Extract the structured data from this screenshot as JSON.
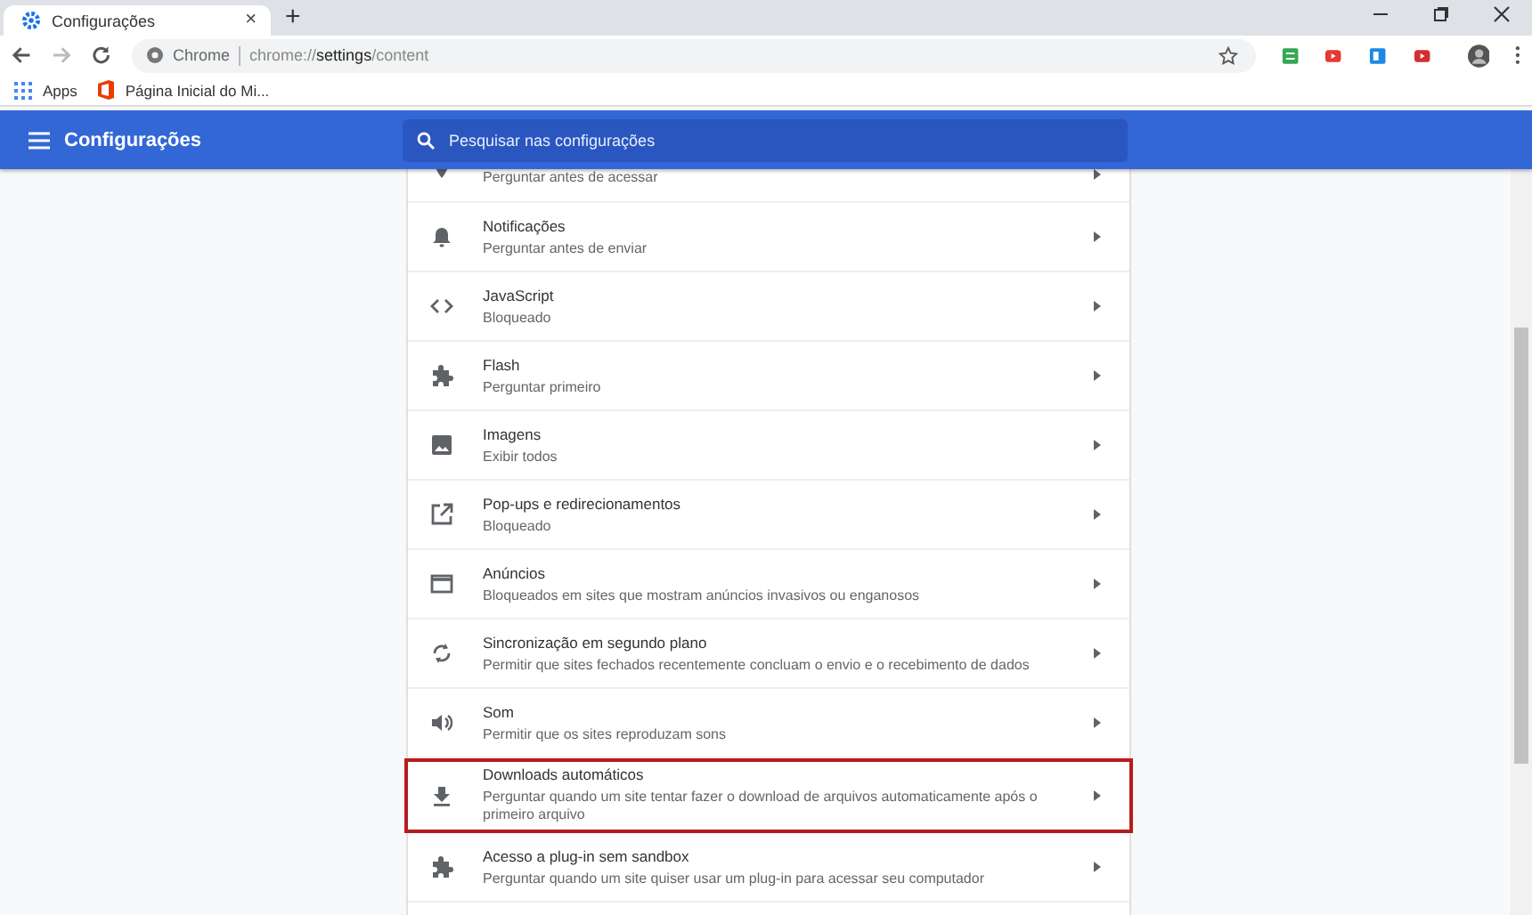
{
  "browser": {
    "tab": {
      "title": "Configurações",
      "close": "×"
    },
    "new_tab": "+",
    "omnibox": {
      "site": "Chrome",
      "url": "chrome://**settings**/content"
    },
    "bookmarks": [
      {
        "label": "Apps",
        "kind": "apps"
      },
      {
        "label": "Página Inicial do Mi...",
        "kind": "office"
      }
    ]
  },
  "header": {
    "title": "Configurações",
    "search": {
      "placeholder": "Pesquisar nas configurações"
    }
  },
  "rows": [
    {
      "kind": "location",
      "subtitle": "Perguntar antes de acessar",
      "partial": true,
      "highlighted": false
    },
    {
      "kind": "bell",
      "title": "Notificações",
      "subtitle": "Perguntar antes de enviar",
      "highlighted": false
    },
    {
      "kind": "code",
      "title": "JavaScript",
      "subtitle": "Bloqueado",
      "highlighted": false
    },
    {
      "kind": "puzzle",
      "title": "Flash",
      "subtitle": "Perguntar primeiro",
      "highlighted": false
    },
    {
      "kind": "image",
      "title": "Imagens",
      "subtitle": "Exibir todos",
      "highlighted": false
    },
    {
      "kind": "popup",
      "title": "Pop-ups e redirecionamentos",
      "subtitle": "Bloqueado",
      "highlighted": false
    },
    {
      "kind": "window",
      "title": "Anúncios",
      "subtitle": "Bloqueados em sites que mostram anúncios invasivos ou enganosos",
      "highlighted": false
    },
    {
      "kind": "sync",
      "title": "Sincronização em segundo plano",
      "subtitle": "Permitir que sites fechados recentemente concluam o envio e o recebimento de dados",
      "highlighted": false
    },
    {
      "kind": "sound",
      "title": "Som",
      "subtitle": "Permitir que os sites reproduzam sons",
      "highlighted": false
    },
    {
      "kind": "download",
      "title": "Downloads automáticos",
      "subtitle": "Perguntar quando um site tentar fazer o download de arquivos automaticamente após o primeiro arquivo",
      "highlighted": true
    },
    {
      "kind": "puzzle",
      "title": "Acesso a plug-in sem sandbox",
      "subtitle": "Perguntar quando um site quiser usar um plug-in para acessar seu computador",
      "highlighted": false
    }
  ]
}
